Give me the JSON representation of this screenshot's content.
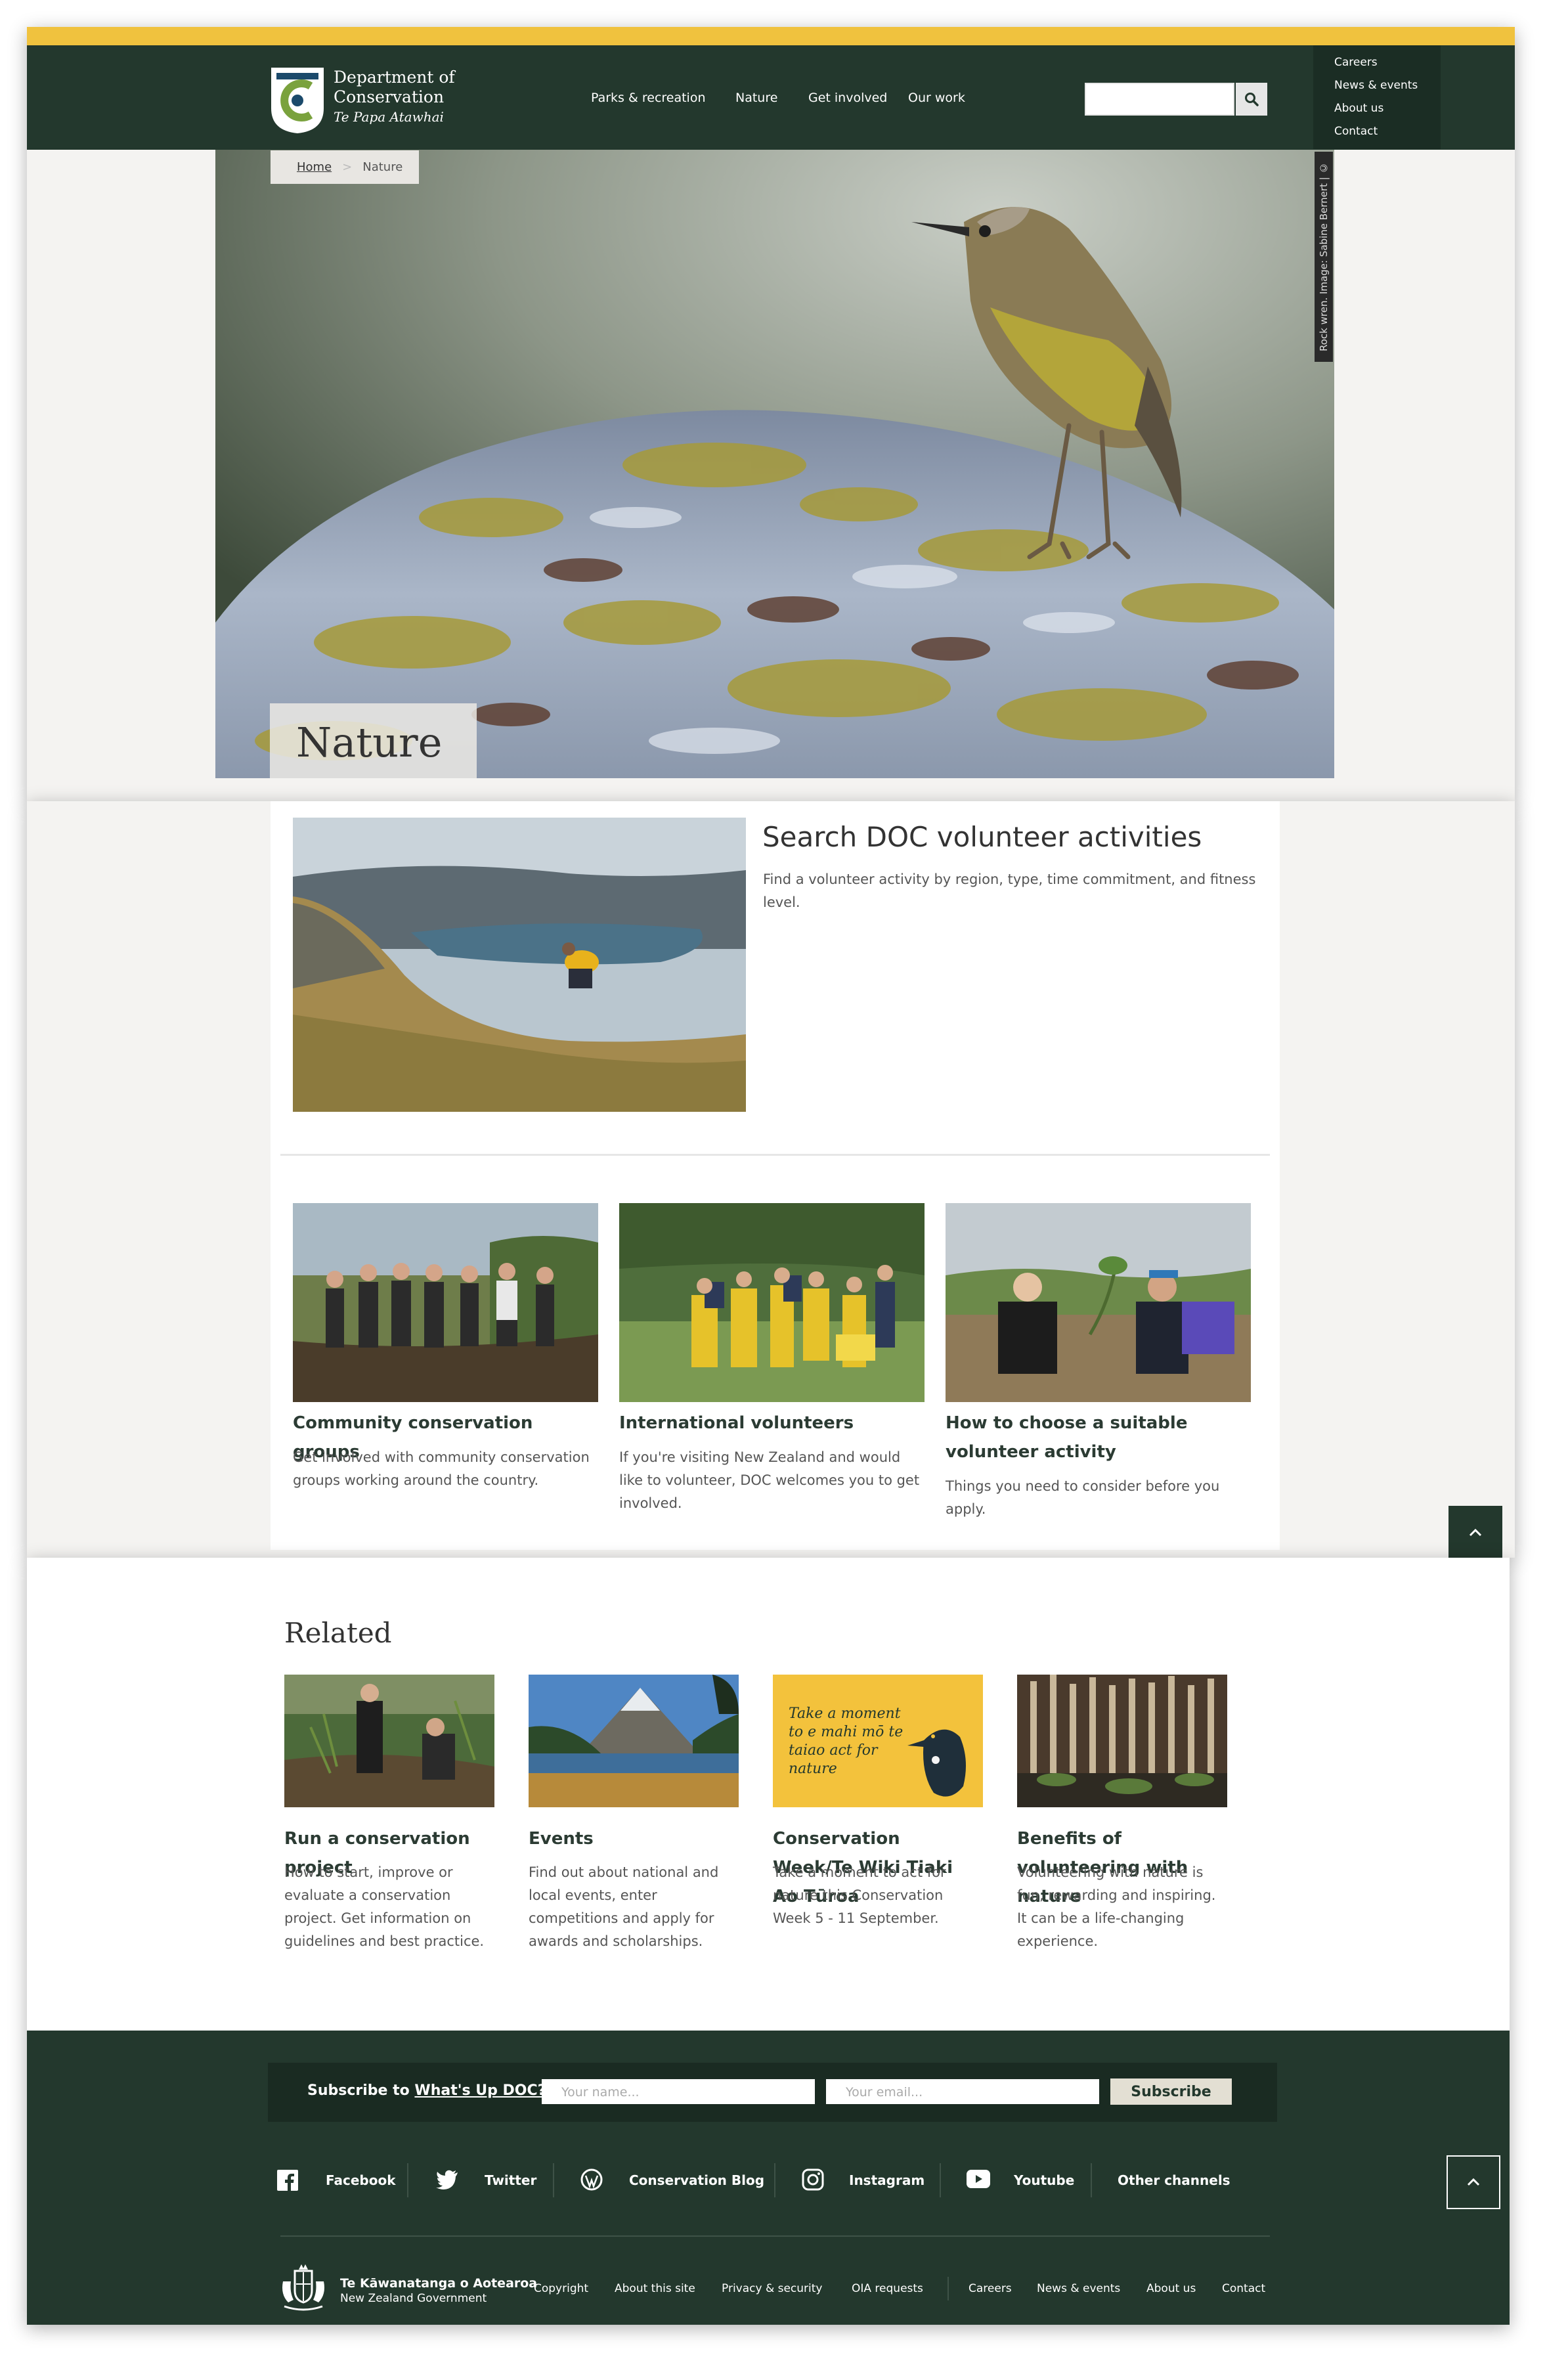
{
  "header": {
    "logo_line1": "Department of",
    "logo_line2": "Conservation",
    "logo_line3": "Te Papa Atawhai",
    "nav": [
      "Parks & recreation",
      "Nature",
      "Get involved",
      "Our work"
    ],
    "search_placeholder": "",
    "utility_links": [
      "Careers",
      "News & events",
      "About us",
      "Contact"
    ]
  },
  "breadcrumb": {
    "home": "Home",
    "current": "Nature"
  },
  "hero": {
    "title": "Nature",
    "credit": "Rock wren. Image: Sabine Bernert | ©"
  },
  "featured": {
    "title": "Search DOC volunteer activities",
    "description": "Find a volunteer activity by region, type, time commitment, and fitness level."
  },
  "cards": [
    {
      "title": "Community conservation groups",
      "description": "Get involved with community conservation groups working around the country."
    },
    {
      "title": "International volunteers",
      "description": "If you're visiting New Zealand and would like to volunteer, DOC welcomes you to get involved."
    },
    {
      "title": "How to choose a suitable volunteer activity",
      "description": "Things you need to consider before you apply."
    }
  ],
  "related": {
    "heading": "Related",
    "items": [
      {
        "title": "Run a conservation project",
        "description": "How to start, improve or evaluate a conservation project. Get information on guidelines and best practice."
      },
      {
        "title": "Events",
        "description": "Find out about national and local events, enter competitions and apply for awards and scholarships."
      },
      {
        "title": "Conservation Week/Te Wiki Tiaki Ao Tūroa",
        "description": "Take a moment to act for nature this Conservation Week 5 - 11 September.",
        "image_text": "Take a moment to e mahi mō te taiao act for nature"
      },
      {
        "title": "Benefits of volunteering with nature",
        "description": "Volunteering with nature is fun, rewarding and inspiring. It can be a life-changing experience."
      }
    ]
  },
  "footer": {
    "subscribe_label": "Subscribe to",
    "subscribe_link": "What's Up DOC?",
    "name_placeholder": "Your name...",
    "email_placeholder": "Your email...",
    "subscribe_button": "Subscribe",
    "social": [
      "Facebook",
      "Twitter",
      "Conservation Blog",
      "Instagram",
      "Youtube",
      "Other channels"
    ],
    "govt_line1": "Te Kāwanatanga o Aotearoa",
    "govt_line2": "New Zealand Government",
    "legal_links": [
      "Copyright",
      "About this site",
      "Privacy & security",
      "OIA requests"
    ],
    "utility_links": [
      "Careers",
      "News & events",
      "About us",
      "Contact"
    ]
  },
  "colors": {
    "brand_dark": "#23382d",
    "accent_yellow": "#f0c23e",
    "logo_green": "#7aa23d",
    "logo_navy": "#1b4a6b"
  }
}
